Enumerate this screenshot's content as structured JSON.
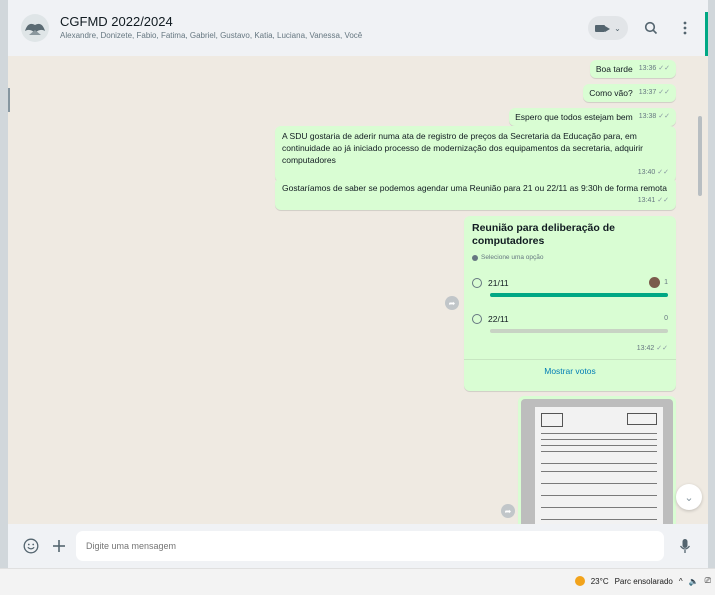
{
  "header": {
    "title": "CGFMD 2022/2024",
    "members": "Alexandre, Donizete, Fabio, Fatima, Gabriel, Gustavo, Katia, Luciana, Vanessa, Você"
  },
  "messages": [
    {
      "text": "Boa tarde",
      "time": "13:36"
    },
    {
      "text": "Como vão?",
      "time": "13:37"
    },
    {
      "text": "Espero que todos estejam bem",
      "time": "13:38"
    },
    {
      "text": "A SDU gostaria de aderir numa ata de registro de preços da Secretaria da Educação para, em continuidade ao já iniciado processo de modernização dos equipamentos da secretaria, adquirir computadores",
      "time": "13:40"
    },
    {
      "text": "Gostaríamos de saber se podemos agendar uma Reunião para 21 ou 22/11 as 9:30h de forma remota",
      "time": "13:41"
    }
  ],
  "poll": {
    "question": "Reunião para deliberação de computadores",
    "instruction": "Selecione uma opção",
    "options": [
      {
        "label": "21/11",
        "votes": "1",
        "fraction": 1.0
      },
      {
        "label": "22/11",
        "votes": "0",
        "fraction": 0.0
      }
    ],
    "time": "13:42",
    "show_votes": "Mostrar votos"
  },
  "composer": {
    "placeholder": "Digite uma mensagem"
  },
  "taskbar": {
    "weather_temp": "23°C",
    "weather_desc": "Parc ensolarado"
  },
  "colors": {
    "outgoing_bubble": "#d9fdd3",
    "chat_background": "#efeae2",
    "accent": "#00a884",
    "link": "#027eb5"
  }
}
